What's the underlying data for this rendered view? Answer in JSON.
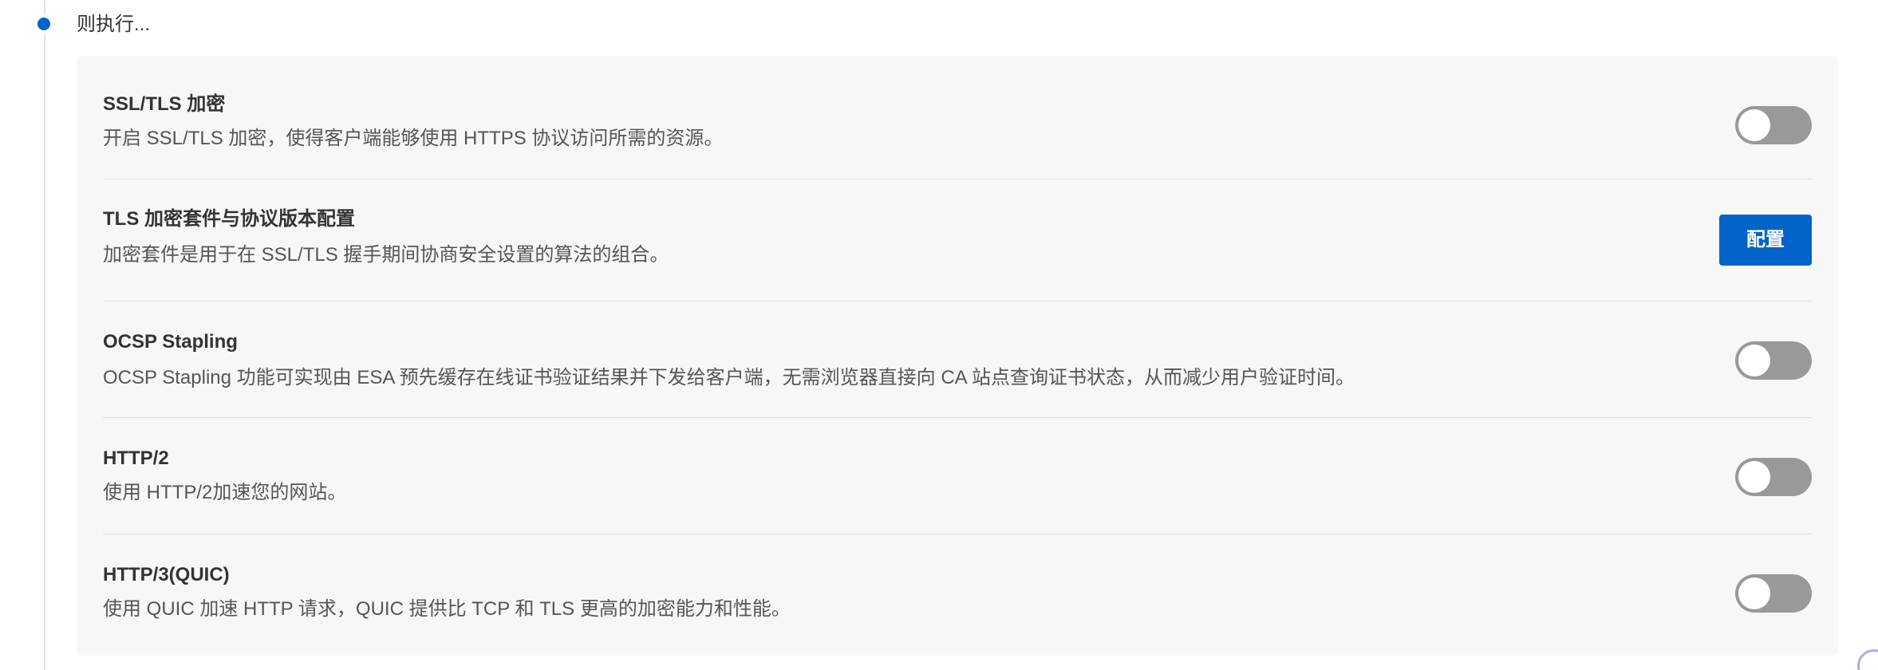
{
  "step": {
    "title": "则执行..."
  },
  "settings": [
    {
      "title": "SSL/TLS 加密",
      "description": "开启 SSL/TLS 加密，使得客户端能够使用 HTTPS 协议访问所需的资源。",
      "control": "toggle",
      "enabled": false
    },
    {
      "title": "TLS 加密套件与协议版本配置",
      "description": "加密套件是用于在 SSL/TLS 握手期间协商安全设置的算法的组合。",
      "control": "button",
      "button_label": "配置"
    },
    {
      "title": "OCSP Stapling",
      "description": "OCSP Stapling 功能可实现由 ESA 预先缓存在线证书验证结果并下发给客户端，无需浏览器直接向 CA 站点查询证书状态，从而减少用户验证时间。",
      "control": "toggle",
      "enabled": false
    },
    {
      "title": "HTTP/2",
      "description": "使用 HTTP/2加速您的网站。",
      "control": "toggle",
      "enabled": false
    },
    {
      "title": "HTTP/3(QUIC)",
      "description": "使用 QUIC 加速 HTTP 请求，QUIC 提供比 TCP 和 TLS 更高的加密能力和性能。",
      "control": "toggle",
      "enabled": false
    }
  ],
  "colors": {
    "accent": "#0064c8",
    "toggle_off": "#999999",
    "card_bg": "#f7f7f7"
  }
}
